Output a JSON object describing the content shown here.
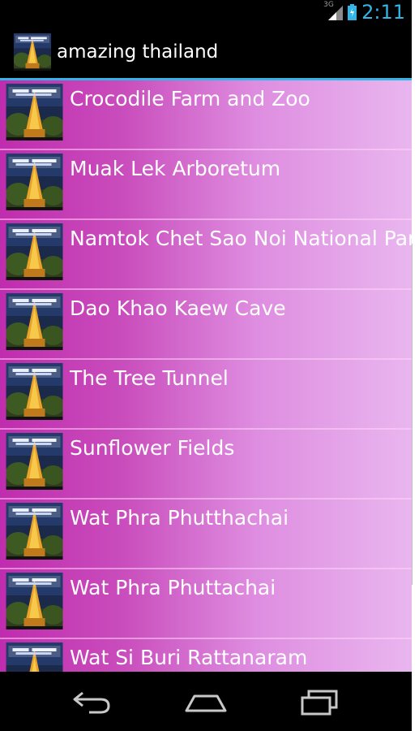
{
  "status_bar": {
    "network": "3G",
    "time": "2:11",
    "icons": [
      "signal-icon",
      "battery-icon"
    ]
  },
  "action_bar": {
    "app_icon": "app-thumbnail-icon",
    "title": "amazing thailand"
  },
  "list": {
    "items": [
      {
        "label": "Crocodile Farm and Zoo"
      },
      {
        "label": "Muak Lek Arboretum"
      },
      {
        "label": "Namtok Chet Sao Noi National Par"
      },
      {
        "label": "Dao Khao Kaew Cave"
      },
      {
        "label": "The Tree Tunnel"
      },
      {
        "label": "Sunflower Fields"
      },
      {
        "label": "Wat Phra Phutthachai"
      },
      {
        "label": "Wat Phra Phuttachai"
      },
      {
        "label": "Wat Si Buri Rattanaram"
      }
    ]
  },
  "nav_bar": {
    "buttons": [
      "back-icon",
      "home-icon",
      "recent-apps-icon"
    ]
  },
  "colors": {
    "accent": "#33b5e5",
    "list_gradient_start": "#c02cae",
    "list_gradient_end": "#e9b6ef"
  }
}
